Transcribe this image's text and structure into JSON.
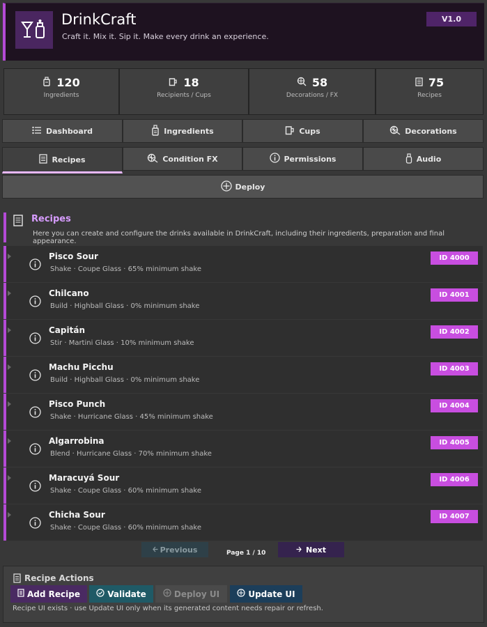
{
  "header": {
    "title": "DrinkCraft",
    "tagline": "Craft it. Mix it. Sip it. Make every drink an experience.",
    "version": "V1.0",
    "logo_icon": "cocktail-glass-shaker-icon"
  },
  "stats": [
    {
      "value": "120",
      "label": "Ingredients",
      "icon": "bottle-icon"
    },
    {
      "value": "18",
      "label": "Recipients / Cups",
      "icon": "cup-icon"
    },
    {
      "value": "58",
      "label": "Decorations / FX",
      "icon": "citrus-icon"
    },
    {
      "value": "75",
      "label": "Recipes",
      "icon": "document-icon"
    }
  ],
  "tabs": [
    {
      "label": "Dashboard",
      "icon": "list-icon"
    },
    {
      "label": "Ingredients",
      "icon": "bottle-icon"
    },
    {
      "label": "Cups",
      "icon": "cup-icon"
    },
    {
      "label": "Decorations",
      "icon": "citrus-icon"
    },
    {
      "label": "Recipes",
      "icon": "document-icon",
      "active": true
    },
    {
      "label": "Condition FX",
      "icon": "citrus-icon"
    },
    {
      "label": "Permissions",
      "icon": "info-icon"
    },
    {
      "label": "Audio",
      "icon": "bottle-icon"
    }
  ],
  "deploy_tab": {
    "label": "Deploy",
    "icon": "globe-plus-icon"
  },
  "section": {
    "title": "Recipes",
    "description": "Here you can create and configure the drinks available in DrinkCraft, including their ingredients, preparation and final appearance."
  },
  "recipes": [
    {
      "name": "Pisco Sour",
      "meta": "Shake · Coupe Glass · 65% minimum shake",
      "id": "ID 4000"
    },
    {
      "name": "Chilcano",
      "meta": "Build · Highball Glass · 0% minimum shake",
      "id": "ID 4001"
    },
    {
      "name": "Capitán",
      "meta": "Stir · Martini Glass · 10% minimum shake",
      "id": "ID 4002"
    },
    {
      "name": "Machu Picchu",
      "meta": "Build · Highball Glass · 0% minimum shake",
      "id": "ID 4003"
    },
    {
      "name": "Pisco Punch",
      "meta": "Shake · Hurricane Glass · 45% minimum shake",
      "id": "ID 4004"
    },
    {
      "name": "Algarrobina",
      "meta": "Blend · Hurricane Glass · 70% minimum shake",
      "id": "ID 4005"
    },
    {
      "name": "Maracuyá Sour",
      "meta": "Shake · Coupe Glass · 60% minimum shake",
      "id": "ID 4006"
    },
    {
      "name": "Chicha Sour",
      "meta": "Shake · Coupe Glass · 60% minimum shake",
      "id": "ID 4007"
    }
  ],
  "pager": {
    "previous": "Previous",
    "next": "Next",
    "page": "Page 1 / 10"
  },
  "actions": {
    "title": "Recipe Actions",
    "add": "Add Recipe",
    "validate": "Validate",
    "deploy_ui": "Deploy UI",
    "update_ui": "Update UI",
    "note": "Recipe UI exists · use Update UI only when its generated content needs repair or refresh."
  },
  "colors": {
    "accent": "#b44ad6",
    "id_badge": "#c84ee0",
    "background": "#383838"
  }
}
